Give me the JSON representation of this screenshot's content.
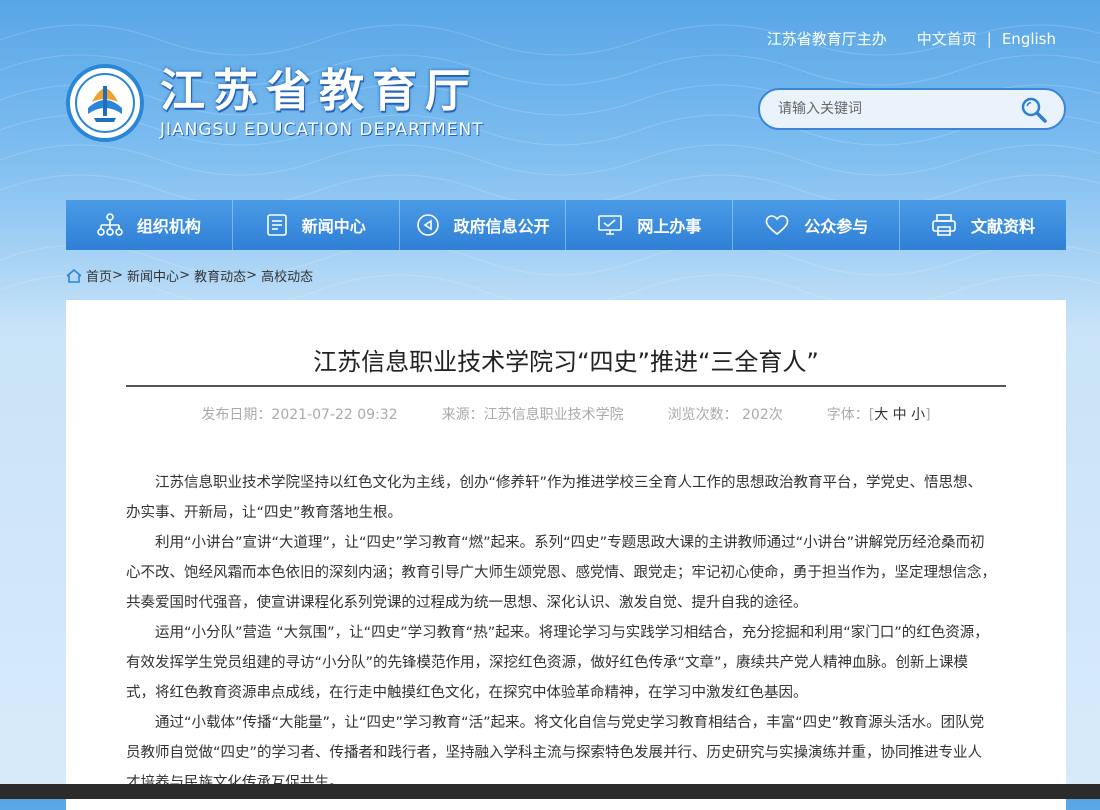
{
  "header": {
    "sponsor": "江苏省教育厅主办",
    "home_cn": "中文首页",
    "separator": "|",
    "english": "English",
    "logo_cn": "江苏省教育厅",
    "logo_en": "JIANGSU EDUCATION DEPARTMENT"
  },
  "search": {
    "placeholder": "请输入关键词"
  },
  "nav": {
    "items": [
      {
        "label": "组织机构",
        "icon": "org-chart-icon"
      },
      {
        "label": "新闻中心",
        "icon": "document-icon"
      },
      {
        "label": "政府信息公开",
        "icon": "speaker-icon"
      },
      {
        "label": "网上办事",
        "icon": "monitor-icon"
      },
      {
        "label": "公众参与",
        "icon": "heart-icon"
      },
      {
        "label": "文献资料",
        "icon": "printer-icon"
      }
    ]
  },
  "breadcrumb": {
    "items": [
      "首页",
      "新闻中心",
      "教育动态",
      "高校动态"
    ],
    "sep": "> "
  },
  "article": {
    "title": "江苏信息职业技术学院习“四史”推进“三全育人”",
    "date": "发布日期：2021-07-22 09:32",
    "source": "来源：江苏信息职业技术学院",
    "views": "浏览次数： 202次",
    "font_label": "字体：",
    "font_open": "[",
    "font_large": "大",
    "font_medium": "中",
    "font_small": "小",
    "font_close": "]",
    "paragraphs": [
      "江苏信息职业技术学院坚持以红色文化为主线，创办“修养轩”作为推进学校三全育人工作的思想政治教育平台，学党史、悟思想、办实事、开新局，让“四史”教育落地生根。",
      "利用“小讲台”宣讲“大道理”，让“四史”学习教育“燃”起来。系列“四史”专题思政大课的主讲教师通过“小讲台”讲解党历经沧桑而初心不改、饱经风霜而本色依旧的深刻内涵；教育引导广大师生颂党恩、感党情、跟党走；牢记初心使命，勇于担当作为，坚定理想信念，共奏爱国时代强音，使宣讲课程化系列党课的过程成为统一思想、深化认识、激发自觉、提升自我的途径。",
      "运用“小分队”营造 “大氛围”，让“四史”学习教育“热”起来。将理论学习与实践学习相结合，充分挖掘和利用“家门口”的红色资源，有效发挥学生党员组建的寻访“小分队”的先锋模范作用，深挖红色资源，做好红色传承“文章”，赓续共产党人精神血脉。创新上课模式，将红色教育资源串点成线，在行走中触摸红色文化，在探究中体验革命精神，在学习中激发红色基因。",
      "通过“小载体”传播“大能量”，让“四史”学习教育“活”起来。将文化自信与党史学习教育相结合，丰富“四史”教育源头活水。团队党员教师自觉做“四史”的学习者、传播者和践行者，坚持融入学科主流与探索特色发展并行、历史研究与实操演练并重，协同推进专业人才培养与民族文化传承互促共生。"
    ]
  }
}
